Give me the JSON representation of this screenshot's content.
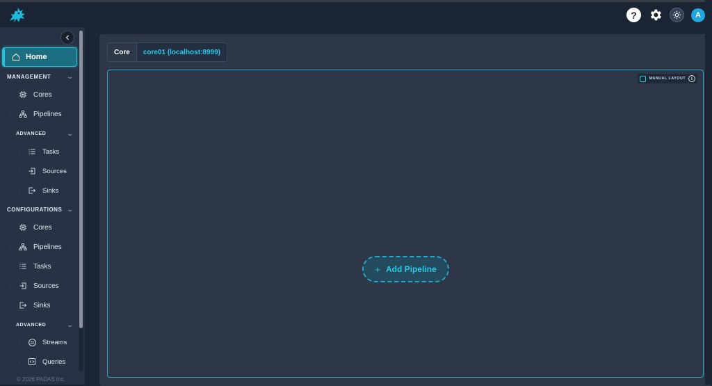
{
  "app": {
    "logo_icon": "dragon-logo-icon"
  },
  "topbar": {
    "help_label": "?",
    "avatar_initial": "A"
  },
  "sidebar": {
    "home_label": "Home",
    "management_label": "MANAGEMENT",
    "management_items": [
      {
        "label": "Cores",
        "icon": "cpu-icon"
      },
      {
        "label": "Pipelines",
        "icon": "hierarchy-icon"
      }
    ],
    "management_advanced_label": "ADVANCED",
    "management_advanced_items": [
      {
        "label": "Tasks",
        "icon": "list-icon"
      },
      {
        "label": "Sources",
        "icon": "source-icon"
      },
      {
        "label": "Sinks",
        "icon": "sink-icon"
      }
    ],
    "configurations_label": "CONFIGURATIONS",
    "configurations_items": [
      {
        "label": "Cores",
        "icon": "cpu-icon"
      },
      {
        "label": "Pipelines",
        "icon": "hierarchy-icon"
      },
      {
        "label": "Tasks",
        "icon": "list-icon"
      },
      {
        "label": "Sources",
        "icon": "source-icon"
      },
      {
        "label": "Sinks",
        "icon": "sink-icon"
      }
    ],
    "configurations_advanced_label": "ADVANCED",
    "configurations_advanced_items": [
      {
        "label": "Streams",
        "icon": "streams-icon"
      },
      {
        "label": "Queries",
        "icon": "code-icon"
      }
    ],
    "copyright": "© 2026 PADAS Inc."
  },
  "main": {
    "core_label": "Core",
    "core_value": "core01 (localhost:8999)",
    "manual_layout_label": "MANUAL LAYOUT",
    "info_symbol": "i",
    "add_pipeline_plus": "+",
    "add_pipeline_label": "Add Pipeline"
  },
  "colors": {
    "accent": "#2bc8e6",
    "background": "#1c2533",
    "panel": "#2d3748",
    "sidebar": "#273244"
  }
}
